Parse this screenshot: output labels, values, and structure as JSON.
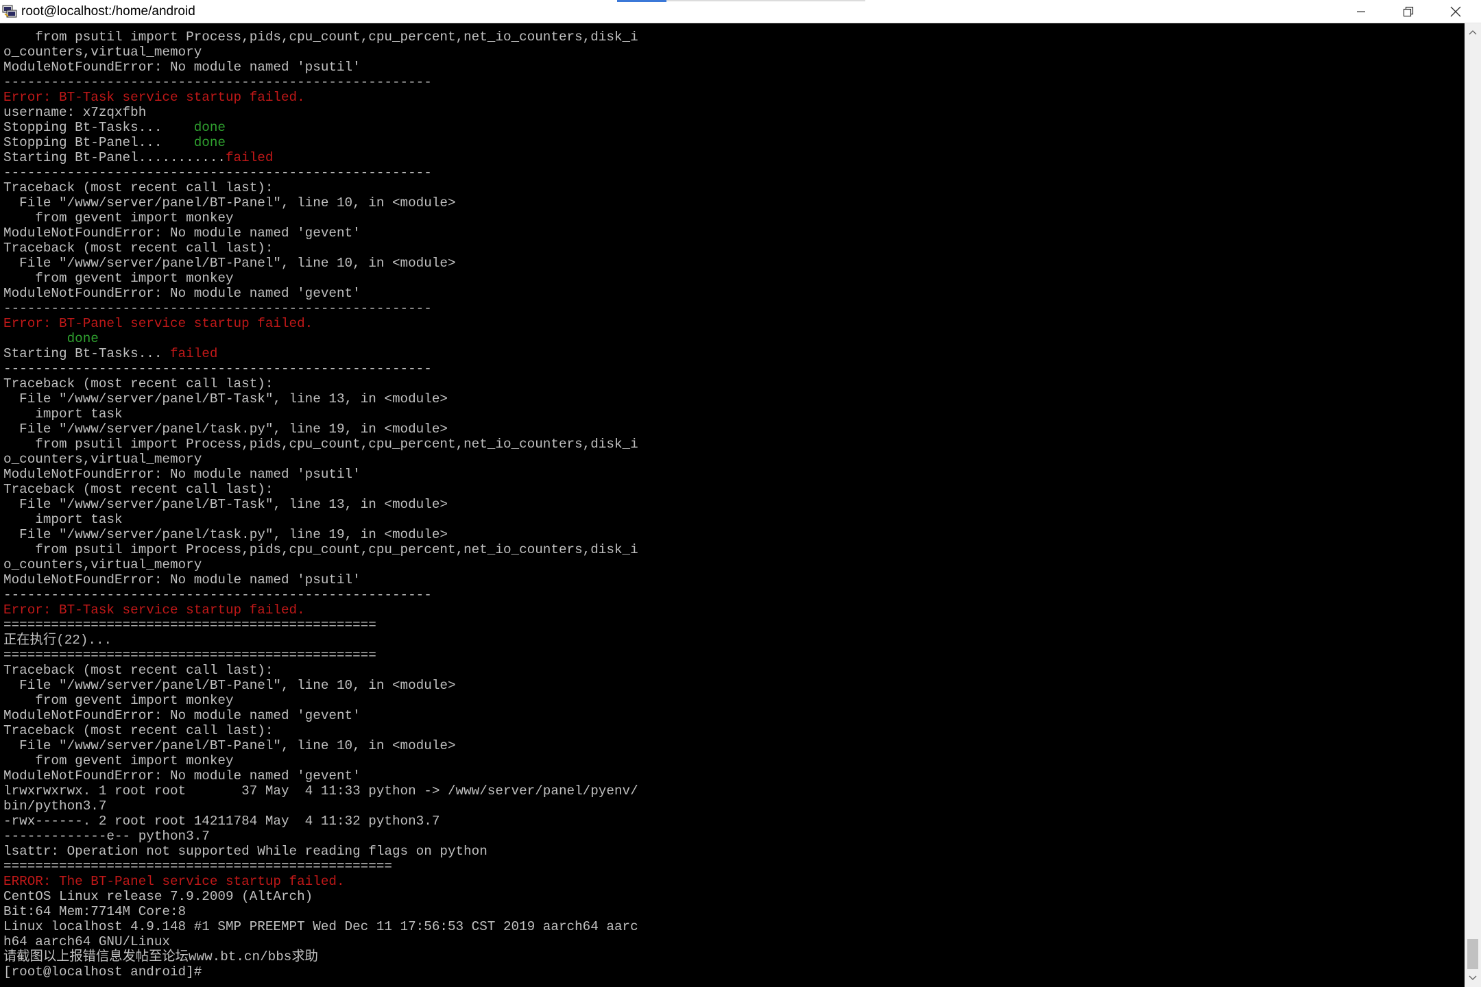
{
  "window": {
    "title": "root@localhost:/home/android",
    "icon": "putty-terminal-icon",
    "controls": {
      "minimize": "minimize-icon",
      "maximize": "restore-icon",
      "close": "close-icon"
    }
  },
  "colors": {
    "background": "#000000",
    "text": "#c0c0c0",
    "error": "#c01818",
    "success": "#2fa12f"
  },
  "terminal": {
    "lines": [
      [
        {
          "t": "    from psutil import Process,pids,cpu_count,cpu_percent,net_io_counters,disk_i",
          "c": "normal"
        }
      ],
      [
        {
          "t": "o_counters,virtual_memory",
          "c": "normal"
        }
      ],
      [
        {
          "t": "ModuleNotFoundError: No module named 'psutil'",
          "c": "normal"
        }
      ],
      [
        {
          "t": "------------------------------------------------------",
          "c": "normal"
        }
      ],
      [
        {
          "t": "Error: BT-Task service startup failed.",
          "c": "red"
        }
      ],
      [
        {
          "t": "username: x7zqxfbh",
          "c": "normal"
        }
      ],
      [
        {
          "t": "Stopping Bt-Tasks...    ",
          "c": "normal"
        },
        {
          "t": "done",
          "c": "green"
        }
      ],
      [
        {
          "t": "Stopping Bt-Panel...    ",
          "c": "normal"
        },
        {
          "t": "done",
          "c": "green"
        }
      ],
      [
        {
          "t": "Starting Bt-Panel...........",
          "c": "normal"
        },
        {
          "t": "failed",
          "c": "red"
        }
      ],
      [
        {
          "t": "------------------------------------------------------",
          "c": "normal"
        }
      ],
      [
        {
          "t": "Traceback (most recent call last):",
          "c": "normal"
        }
      ],
      [
        {
          "t": "  File \"/www/server/panel/BT-Panel\", line 10, in <module>",
          "c": "normal"
        }
      ],
      [
        {
          "t": "    from gevent import monkey",
          "c": "normal"
        }
      ],
      [
        {
          "t": "ModuleNotFoundError: No module named 'gevent'",
          "c": "normal"
        }
      ],
      [
        {
          "t": "Traceback (most recent call last):",
          "c": "normal"
        }
      ],
      [
        {
          "t": "  File \"/www/server/panel/BT-Panel\", line 10, in <module>",
          "c": "normal"
        }
      ],
      [
        {
          "t": "    from gevent import monkey",
          "c": "normal"
        }
      ],
      [
        {
          "t": "ModuleNotFoundError: No module named 'gevent'",
          "c": "normal"
        }
      ],
      [
        {
          "t": "------------------------------------------------------",
          "c": "normal"
        }
      ],
      [
        {
          "t": "Error: BT-Panel service startup failed.",
          "c": "red"
        }
      ],
      [
        {
          "t": "        ",
          "c": "normal"
        },
        {
          "t": "done",
          "c": "green"
        }
      ],
      [
        {
          "t": "Starting Bt-Tasks... ",
          "c": "normal"
        },
        {
          "t": "failed",
          "c": "red"
        }
      ],
      [
        {
          "t": "------------------------------------------------------",
          "c": "normal"
        }
      ],
      [
        {
          "t": "Traceback (most recent call last):",
          "c": "normal"
        }
      ],
      [
        {
          "t": "  File \"/www/server/panel/BT-Task\", line 13, in <module>",
          "c": "normal"
        }
      ],
      [
        {
          "t": "    import task",
          "c": "normal"
        }
      ],
      [
        {
          "t": "  File \"/www/server/panel/task.py\", line 19, in <module>",
          "c": "normal"
        }
      ],
      [
        {
          "t": "    from psutil import Process,pids,cpu_count,cpu_percent,net_io_counters,disk_i",
          "c": "normal"
        }
      ],
      [
        {
          "t": "o_counters,virtual_memory",
          "c": "normal"
        }
      ],
      [
        {
          "t": "ModuleNotFoundError: No module named 'psutil'",
          "c": "normal"
        }
      ],
      [
        {
          "t": "Traceback (most recent call last):",
          "c": "normal"
        }
      ],
      [
        {
          "t": "  File \"/www/server/panel/BT-Task\", line 13, in <module>",
          "c": "normal"
        }
      ],
      [
        {
          "t": "    import task",
          "c": "normal"
        }
      ],
      [
        {
          "t": "  File \"/www/server/panel/task.py\", line 19, in <module>",
          "c": "normal"
        }
      ],
      [
        {
          "t": "    from psutil import Process,pids,cpu_count,cpu_percent,net_io_counters,disk_i",
          "c": "normal"
        }
      ],
      [
        {
          "t": "o_counters,virtual_memory",
          "c": "normal"
        }
      ],
      [
        {
          "t": "ModuleNotFoundError: No module named 'psutil'",
          "c": "normal"
        }
      ],
      [
        {
          "t": "------------------------------------------------------",
          "c": "normal"
        }
      ],
      [
        {
          "t": "Error: BT-Task service startup failed.",
          "c": "red"
        }
      ],
      [
        {
          "t": "===============================================",
          "c": "normal"
        }
      ],
      [
        {
          "t": "正在执行(22)...",
          "c": "normal"
        }
      ],
      [
        {
          "t": "===============================================",
          "c": "normal"
        }
      ],
      [
        {
          "t": "Traceback (most recent call last):",
          "c": "normal"
        }
      ],
      [
        {
          "t": "  File \"/www/server/panel/BT-Panel\", line 10, in <module>",
          "c": "normal"
        }
      ],
      [
        {
          "t": "    from gevent import monkey",
          "c": "normal"
        }
      ],
      [
        {
          "t": "ModuleNotFoundError: No module named 'gevent'",
          "c": "normal"
        }
      ],
      [
        {
          "t": "Traceback (most recent call last):",
          "c": "normal"
        }
      ],
      [
        {
          "t": "  File \"/www/server/panel/BT-Panel\", line 10, in <module>",
          "c": "normal"
        }
      ],
      [
        {
          "t": "    from gevent import monkey",
          "c": "normal"
        }
      ],
      [
        {
          "t": "ModuleNotFoundError: No module named 'gevent'",
          "c": "normal"
        }
      ],
      [
        {
          "t": "lrwxrwxrwx. 1 root root       37 May  4 11:33 python -> /www/server/panel/pyenv/",
          "c": "normal"
        }
      ],
      [
        {
          "t": "bin/python3.7",
          "c": "normal"
        }
      ],
      [
        {
          "t": "-rwx------. 2 root root 14211784 May  4 11:32 python3.7",
          "c": "normal"
        }
      ],
      [
        {
          "t": "-------------e-- python3.7",
          "c": "normal"
        }
      ],
      [
        {
          "t": "lsattr: Operation not supported While reading flags on python",
          "c": "normal"
        }
      ],
      [
        {
          "t": "=================================================",
          "c": "normal"
        }
      ],
      [
        {
          "t": "ERROR: The BT-Panel service startup failed.",
          "c": "red"
        }
      ],
      [
        {
          "t": "CentOS Linux release 7.9.2009 (AltArch)",
          "c": "normal"
        }
      ],
      [
        {
          "t": "Bit:64 Mem:7714M Core:8",
          "c": "normal"
        }
      ],
      [
        {
          "t": "Linux localhost 4.9.148 #1 SMP PREEMPT Wed Dec 11 17:56:53 CST 2019 aarch64 aarc",
          "c": "normal"
        }
      ],
      [
        {
          "t": "h64 aarch64 GNU/Linux",
          "c": "normal"
        }
      ],
      [
        {
          "t": "请截图以上报错信息发帖至论坛www.bt.cn/bbs求助",
          "c": "normal"
        }
      ],
      [
        {
          "t": "[root@localhost android]# ",
          "c": "normal"
        }
      ]
    ]
  },
  "scrollbar": {
    "up_icon": "scroll-up-arrow-icon",
    "down_icon": "scroll-down-arrow-icon",
    "position_fraction": 0.97
  }
}
